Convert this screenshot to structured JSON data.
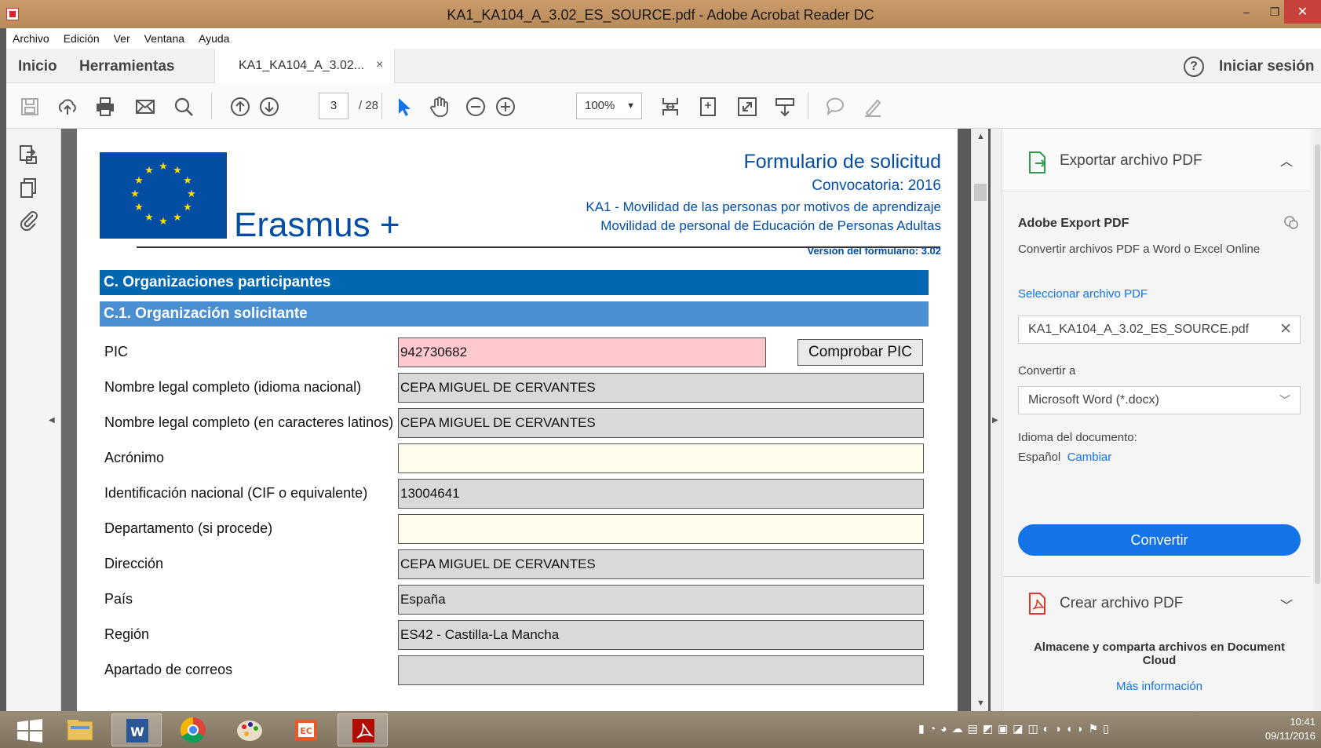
{
  "window": {
    "title": "KA1_KA104_A_3.02_ES_SOURCE.pdf - Adobe Acrobat Reader DC",
    "min": "–",
    "max": "❐",
    "close": "✕"
  },
  "menu": [
    "Archivo",
    "Edición",
    "Ver",
    "Ventana",
    "Ayuda"
  ],
  "tabs": {
    "home": "Inicio",
    "tools": "Herramientas",
    "doc": "KA1_KA104_A_3.02...",
    "doc_close": "×",
    "help": "?",
    "signin": "Iniciar sesión"
  },
  "toolbar": {
    "page_current": "3",
    "page_total": "/ 28",
    "zoom": "100%"
  },
  "document": {
    "brand": "Erasmus +",
    "form_title": "Formulario de solicitud",
    "call": "Convocatoria: 2016",
    "action": "KA1 - Movilidad de las personas por motivos de aprendizaje",
    "sector": "Movilidad de personal de Educación de Personas Adultas",
    "version": "Versión del formulario: 3.02",
    "section": "C. Organizaciones participantes",
    "subsection": "C.1. Organización solicitante",
    "check_pic": "Comprobar PIC",
    "fields": [
      {
        "label": "PIC",
        "value": "942730682",
        "style": "pink"
      },
      {
        "label": "Nombre legal completo (idioma nacional)",
        "value": "CEPA MIGUEL DE CERVANTES",
        "style": "gray"
      },
      {
        "label": "Nombre legal completo (en caracteres latinos)",
        "value": "CEPA MIGUEL DE CERVANTES",
        "style": "gray"
      },
      {
        "label": "Acrónimo",
        "value": "",
        "style": "yellow"
      },
      {
        "label": "Identificación nacional (CIF o equivalente)",
        "value": "13004641",
        "style": "gray"
      },
      {
        "label": "Departamento (si procede)",
        "value": "",
        "style": "yellow"
      },
      {
        "label": "Dirección",
        "value": "CEPA MIGUEL DE CERVANTES",
        "style": "gray"
      },
      {
        "label": "País",
        "value": "España",
        "style": "gray"
      },
      {
        "label": "Región",
        "value": "ES42 - Castilla-La Mancha",
        "style": "gray"
      },
      {
        "label": "Apartado de correos",
        "value": "",
        "style": "gray"
      }
    ]
  },
  "right_panel": {
    "export_title": "Exportar archivo PDF",
    "service": "Adobe Export PDF",
    "service_desc": "Convertir archivos PDF a Word o Excel Online",
    "select_label": "Seleccionar archivo PDF",
    "selected_file": "KA1_KA104_A_3.02_ES_SOURCE.pdf",
    "convert_to_label": "Convertir a",
    "convert_to_value": "Microsoft Word (*.docx)",
    "lang_label": "Idioma del documento:",
    "lang_value": "Español",
    "lang_change": "Cambiar",
    "convert_button": "Convertir",
    "create_title": "Crear archivo PDF",
    "store_text": "Almacene y comparta archivos en Document Cloud",
    "more_info": "Más información"
  },
  "taskbar": {
    "time": "10:41",
    "date": "09/11/2016"
  },
  "colors": {
    "eu_blue": "#034ea2",
    "section_blue": "#0067b0",
    "subsection_blue": "#4a8fd1",
    "acrobat_blue": "#1473e6"
  }
}
